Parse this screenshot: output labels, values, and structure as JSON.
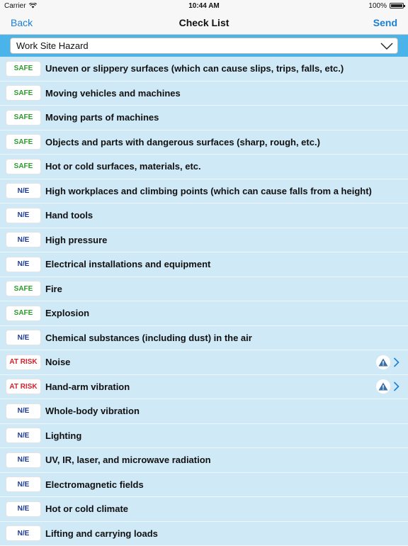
{
  "status_bar": {
    "carrier": "Carrier",
    "time": "10:44 AM",
    "battery": "100%"
  },
  "navbar": {
    "back_label": "Back",
    "title": "Check List",
    "send_label": "Send"
  },
  "dropdown": {
    "selected": "Work Site Hazard"
  },
  "items": [
    {
      "status": "SAFE",
      "label": "Uneven or slippery surfaces (which can cause slips, trips, falls, etc.)"
    },
    {
      "status": "SAFE",
      "label": "Moving vehicles and machines"
    },
    {
      "status": "SAFE",
      "label": "Moving parts of machines"
    },
    {
      "status": "SAFE",
      "label": "Objects and parts with dangerous surfaces (sharp, rough, etc.)"
    },
    {
      "status": "SAFE",
      "label": "Hot or cold surfaces, materials, etc."
    },
    {
      "status": "N/E",
      "label": "High workplaces and climbing points (which can cause falls from a height)"
    },
    {
      "status": "N/E",
      "label": "Hand tools"
    },
    {
      "status": "N/E",
      "label": "High pressure"
    },
    {
      "status": "N/E",
      "label": "Electrical installations and equipment"
    },
    {
      "status": "SAFE",
      "label": "Fire"
    },
    {
      "status": "SAFE",
      "label": "Explosion"
    },
    {
      "status": "N/E",
      "label": "Chemical substances (including dust) in the air"
    },
    {
      "status": "AT RISK",
      "label": "Noise"
    },
    {
      "status": "AT RISK",
      "label": "Hand-arm vibration"
    },
    {
      "status": "N/E",
      "label": "Whole-body vibration"
    },
    {
      "status": "N/E",
      "label": "Lighting"
    },
    {
      "status": "N/E",
      "label": "UV, IR, laser, and microwave radiation"
    },
    {
      "status": "N/E",
      "label": "Electromagnetic fields"
    },
    {
      "status": "N/E",
      "label": "Hot or cold climate"
    },
    {
      "status": "N/E",
      "label": "Lifting and carrying loads"
    }
  ],
  "colors": {
    "accent": "#1a7fd6",
    "header_bar": "#4ab3ea",
    "row_bg": "#cfe9f7",
    "safe": "#2e9a2e",
    "ne": "#1c3a9a",
    "risk": "#d6202a"
  }
}
